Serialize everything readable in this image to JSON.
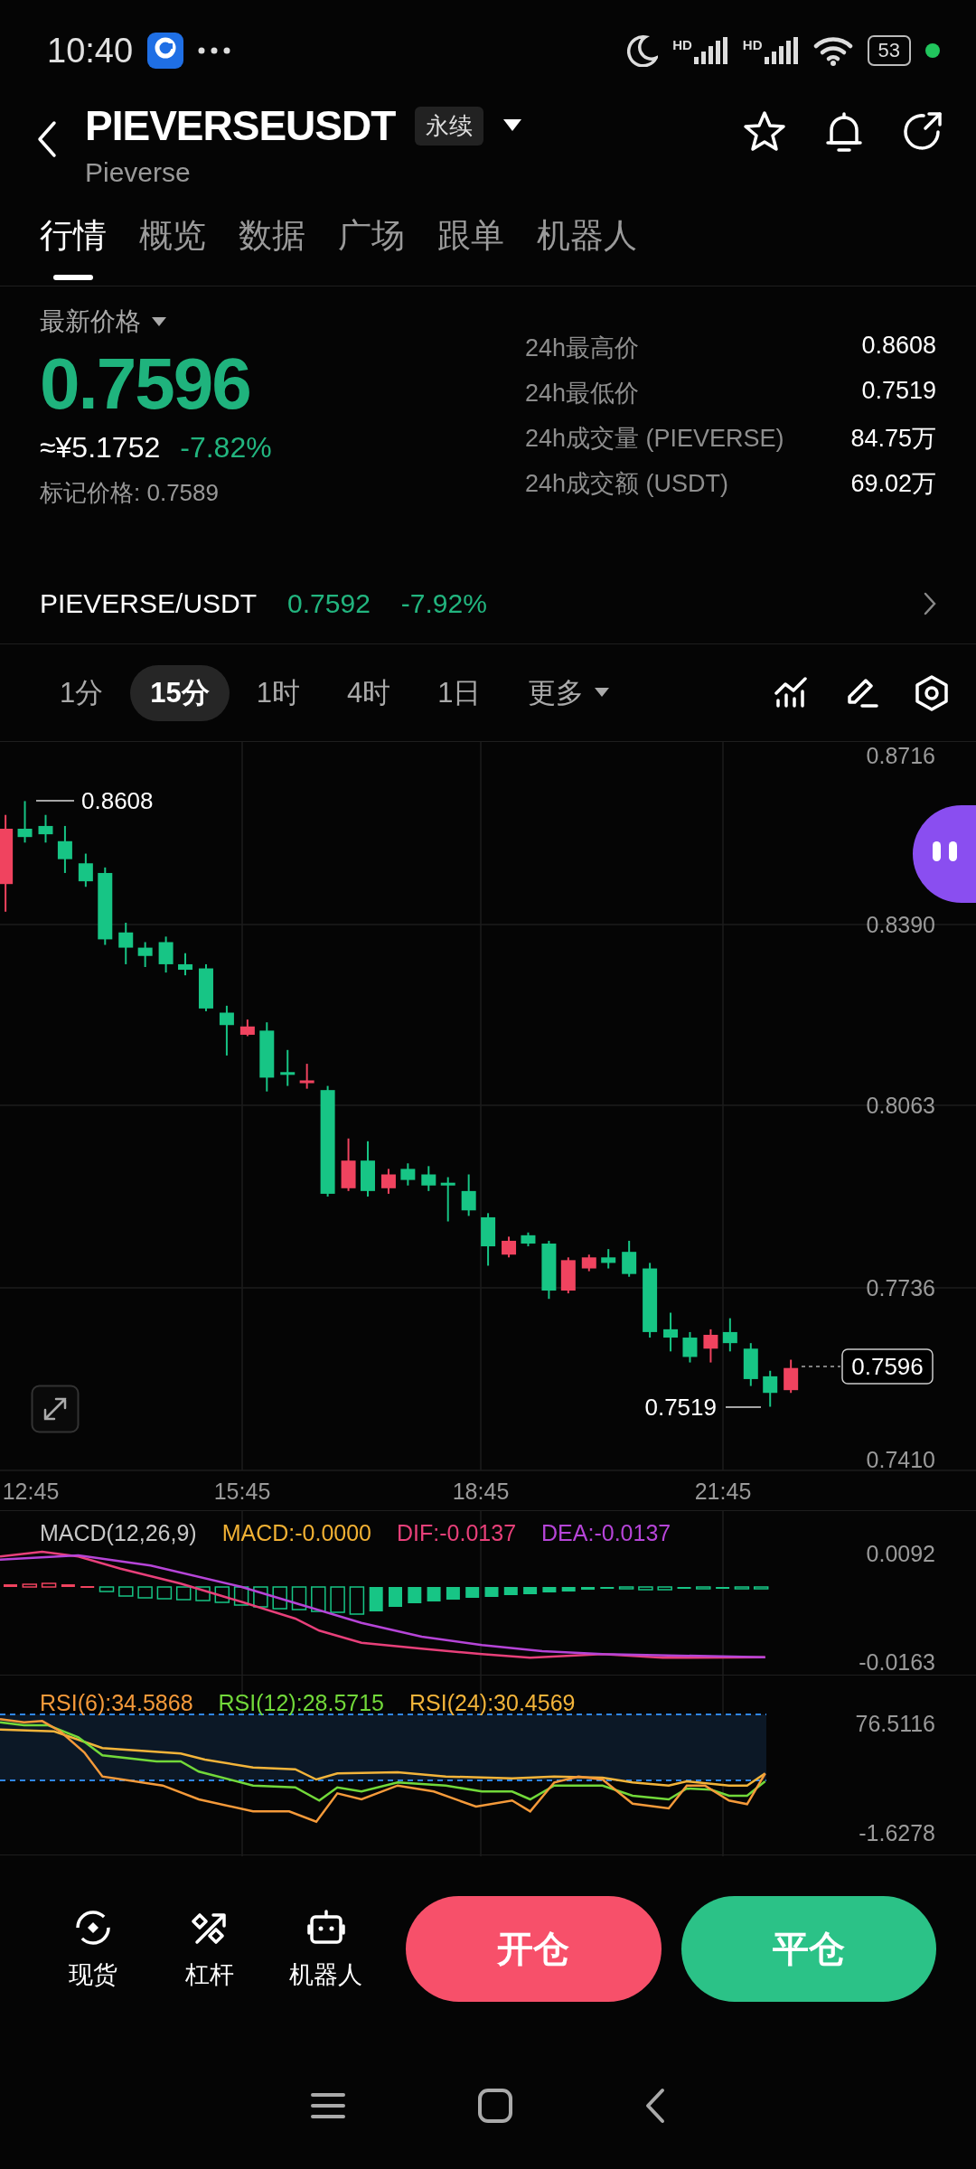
{
  "status_bar": {
    "time": "10:40",
    "signals": [
      {
        "label": "HD"
      },
      {
        "label": "HD"
      }
    ],
    "battery": "53"
  },
  "header": {
    "symbol": "PIEVERSEUSDT",
    "contract_badge": "永续",
    "subtitle": "Pieverse"
  },
  "tabs": [
    {
      "label": "行情",
      "selected": true
    },
    {
      "label": "概览",
      "selected": false
    },
    {
      "label": "数据",
      "selected": false
    },
    {
      "label": "广场",
      "selected": false
    },
    {
      "label": "跟单",
      "selected": false
    },
    {
      "label": "机器人",
      "selected": false
    }
  ],
  "price": {
    "label": "最新价格",
    "last": "0.7596",
    "cny": "≈¥5.1752",
    "change": "-7.82%",
    "mark_price": "标记价格: 0.7589"
  },
  "stats": [
    {
      "label": "24h最高价",
      "value": "0.8608"
    },
    {
      "label": "24h最低价",
      "value": "0.7519"
    },
    {
      "label": "24h成交量 (PIEVERSE)",
      "value": "84.75万"
    },
    {
      "label": "24h成交额 (USDT)",
      "value": "69.02万"
    }
  ],
  "spot_pair": {
    "name": "PIEVERSE/USDT",
    "price": "0.7592",
    "change": "-7.92%"
  },
  "intervals": [
    {
      "label": "1分",
      "selected": false,
      "kind": "plain"
    },
    {
      "label": "15分",
      "selected": true,
      "kind": "plain"
    },
    {
      "label": "1时",
      "selected": false,
      "kind": "plain"
    },
    {
      "label": "4时",
      "selected": false,
      "kind": "plain"
    },
    {
      "label": "1日",
      "selected": false,
      "kind": "plain"
    },
    {
      "label": "更多",
      "selected": false,
      "kind": "dropdown"
    }
  ],
  "chart": {
    "y_labels": [
      "0.8716",
      "0.8390",
      "0.8063",
      "0.7736",
      "0.7410"
    ],
    "x_labels": [
      "12:45",
      "15:45",
      "18:45",
      "21:45"
    ],
    "high_marker": "0.8608",
    "low_marker": "0.7519",
    "last_price_tag": "0.7596"
  },
  "macd": {
    "legend": [
      {
        "text": "MACD(12,26,9)",
        "color": "#c8c8c8"
      },
      {
        "text": "MACD:-0.0000",
        "color": "#f2b134"
      },
      {
        "text": "DIF:-0.0137",
        "color": "#e8407a"
      },
      {
        "text": "DEA:-0.0137",
        "color": "#b645d8"
      }
    ],
    "axis_labels": [
      "0.0092",
      "-0.0163"
    ]
  },
  "rsi": {
    "legend": [
      {
        "text": "RSI(6):34.5868",
        "color": "#f59a3a"
      },
      {
        "text": "RSI(12):28.5715",
        "color": "#72d93a"
      },
      {
        "text": "RSI(24):30.4569",
        "color": "#f3b43a"
      }
    ],
    "axis_labels": [
      "76.5116",
      "-1.6278"
    ]
  },
  "bottom_bar": {
    "shortcuts": [
      {
        "kind": "spot",
        "label": "现货"
      },
      {
        "kind": "leverage",
        "label": "杠杆"
      },
      {
        "kind": "bot",
        "label": "机器人"
      }
    ],
    "actions": [
      {
        "kind": "open",
        "label": "开仓"
      },
      {
        "kind": "close",
        "label": "平仓"
      }
    ]
  }
}
